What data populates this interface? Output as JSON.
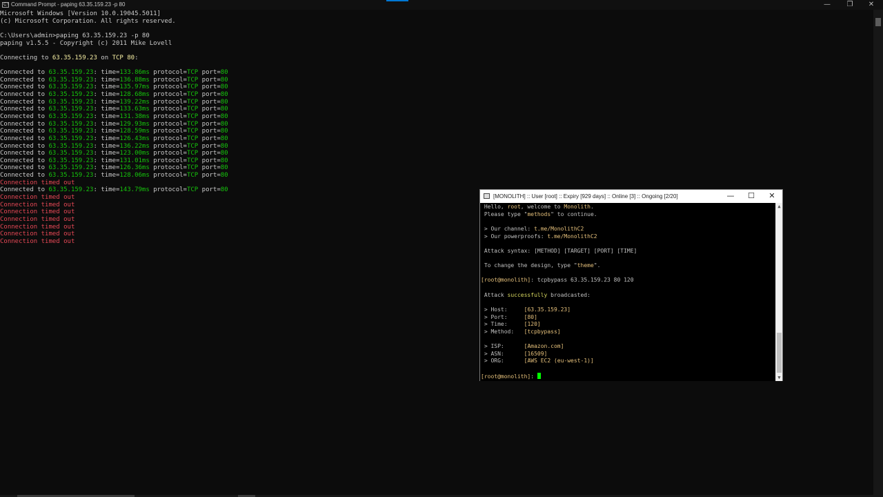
{
  "cmd": {
    "title": "Command Prompt - paping  63.35.159.23 -p 80",
    "controls": {
      "minimize": "—",
      "maximize": "❐",
      "close": "✕"
    },
    "header": [
      "Microsoft Windows [Version 10.0.19045.5011]",
      "(c) Microsoft Corporation. All rights reserved.",
      "",
      "C:\\Users\\admin>paping 63.35.159.23 -p 80",
      "paping v1.5.5 - Copyright (c) 2011 Mike Lovell",
      ""
    ],
    "connecting": {
      "prefix": "Connecting to ",
      "host": "63.35.159.23",
      "on": " on ",
      "proto": "TCP 80",
      "suffix": ":"
    },
    "results": [
      {
        "type": "ok",
        "host": "63.35.159.23",
        "time": "133.86ms",
        "protocol": "TCP",
        "port": "80"
      },
      {
        "type": "ok",
        "host": "63.35.159.23",
        "time": "136.88ms",
        "protocol": "TCP",
        "port": "80"
      },
      {
        "type": "ok",
        "host": "63.35.159.23",
        "time": "135.97ms",
        "protocol": "TCP",
        "port": "80"
      },
      {
        "type": "ok",
        "host": "63.35.159.23",
        "time": "128.68ms",
        "protocol": "TCP",
        "port": "80"
      },
      {
        "type": "ok",
        "host": "63.35.159.23",
        "time": "139.22ms",
        "protocol": "TCP",
        "port": "80"
      },
      {
        "type": "ok",
        "host": "63.35.159.23",
        "time": "133.63ms",
        "protocol": "TCP",
        "port": "80"
      },
      {
        "type": "ok",
        "host": "63.35.159.23",
        "time": "131.38ms",
        "protocol": "TCP",
        "port": "80"
      },
      {
        "type": "ok",
        "host": "63.35.159.23",
        "time": "129.93ms",
        "protocol": "TCP",
        "port": "80"
      },
      {
        "type": "ok",
        "host": "63.35.159.23",
        "time": "128.59ms",
        "protocol": "TCP",
        "port": "80"
      },
      {
        "type": "ok",
        "host": "63.35.159.23",
        "time": "126.43ms",
        "protocol": "TCP",
        "port": "80"
      },
      {
        "type": "ok",
        "host": "63.35.159.23",
        "time": "136.22ms",
        "protocol": "TCP",
        "port": "80"
      },
      {
        "type": "ok",
        "host": "63.35.159.23",
        "time": "123.00ms",
        "protocol": "TCP",
        "port": "80"
      },
      {
        "type": "ok",
        "host": "63.35.159.23",
        "time": "131.01ms",
        "protocol": "TCP",
        "port": "80"
      },
      {
        "type": "ok",
        "host": "63.35.159.23",
        "time": "126.36ms",
        "protocol": "TCP",
        "port": "80"
      },
      {
        "type": "ok",
        "host": "63.35.159.23",
        "time": "128.06ms",
        "protocol": "TCP",
        "port": "80"
      },
      {
        "type": "timeout",
        "text": "Connection timed out"
      },
      {
        "type": "ok",
        "host": "63.35.159.23",
        "time": "143.79ms",
        "protocol": "TCP",
        "port": "80"
      },
      {
        "type": "timeout",
        "text": "Connection timed out"
      },
      {
        "type": "timeout",
        "text": "Connection timed out"
      },
      {
        "type": "timeout",
        "text": "Connection timed out"
      },
      {
        "type": "timeout",
        "text": "Connection timed out"
      },
      {
        "type": "timeout",
        "text": "Connection timed out"
      },
      {
        "type": "timeout",
        "text": "Connection timed out"
      },
      {
        "type": "timeout",
        "text": "Connection timed out"
      }
    ],
    "labels": {
      "connected": "Connected to ",
      "time": ": time=",
      "protocol": " protocol=",
      "port": " port="
    }
  },
  "putty": {
    "title": "[MONOLITH] :: User [root] :: Expiry [929 days] :: Online [3] :: Ongoing [2/20]",
    "controls": {
      "minimize": "—",
      "maximize": "☐",
      "close": "✕"
    },
    "lines": [
      [
        {
          "t": " Hello, "
        },
        {
          "t": "root",
          "c": "pyel"
        },
        {
          "t": ", welcome to "
        },
        {
          "t": "Monolith",
          "c": "pyel"
        },
        {
          "t": "."
        }
      ],
      [
        {
          "t": " Please type \""
        },
        {
          "t": "methods",
          "c": "pyel"
        },
        {
          "t": "\" to continue."
        }
      ],
      [
        {
          "t": ""
        }
      ],
      [
        {
          "t": " > Our channel: "
        },
        {
          "t": "t.me/MonolithC2",
          "c": "pyel"
        }
      ],
      [
        {
          "t": " > Our powerproofs: "
        },
        {
          "t": "t.me/MonolithC2",
          "c": "pyel"
        }
      ],
      [
        {
          "t": ""
        }
      ],
      [
        {
          "t": " Attack syntax: [METHOD] [TARGET] [PORT] [TIME]"
        }
      ],
      [
        {
          "t": ""
        }
      ],
      [
        {
          "t": " To change the design, type \""
        },
        {
          "t": "theme",
          "c": "pyel"
        },
        {
          "t": "\"."
        }
      ],
      [
        {
          "t": ""
        }
      ],
      [
        {
          "t": "[root@monolith]",
          "c": "pyel"
        },
        {
          "t": ": tcpbypass 63.35.159.23 80 120"
        }
      ],
      [
        {
          "t": ""
        }
      ],
      [
        {
          "t": " Attack "
        },
        {
          "t": "successfully",
          "c": "pgrn"
        },
        {
          "t": " broadcasted:"
        }
      ],
      [
        {
          "t": ""
        }
      ],
      [
        {
          "t": " > Host:     "
        },
        {
          "t": "[63.35.159.23]",
          "c": "pyel"
        }
      ],
      [
        {
          "t": " > Port:     "
        },
        {
          "t": "[80]",
          "c": "pyel"
        }
      ],
      [
        {
          "t": " > Time:     "
        },
        {
          "t": "[120]",
          "c": "pyel"
        }
      ],
      [
        {
          "t": " > Method:   "
        },
        {
          "t": "[tcpbypass]",
          "c": "pyel"
        }
      ],
      [
        {
          "t": ""
        }
      ],
      [
        {
          "t": " > ISP:      "
        },
        {
          "t": "[Amazon.com]",
          "c": "pyel"
        }
      ],
      [
        {
          "t": " > ASN:      "
        },
        {
          "t": "[16509]",
          "c": "pyel"
        }
      ],
      [
        {
          "t": " > ORG:      "
        },
        {
          "t": "[AWS EC2 (eu-west-1)]",
          "c": "pyel"
        }
      ],
      [
        {
          "t": ""
        }
      ],
      [
        {
          "t": "[root@monolith]",
          "c": "pyel"
        },
        {
          "t": ": "
        },
        {
          "cursor": true
        }
      ]
    ]
  }
}
